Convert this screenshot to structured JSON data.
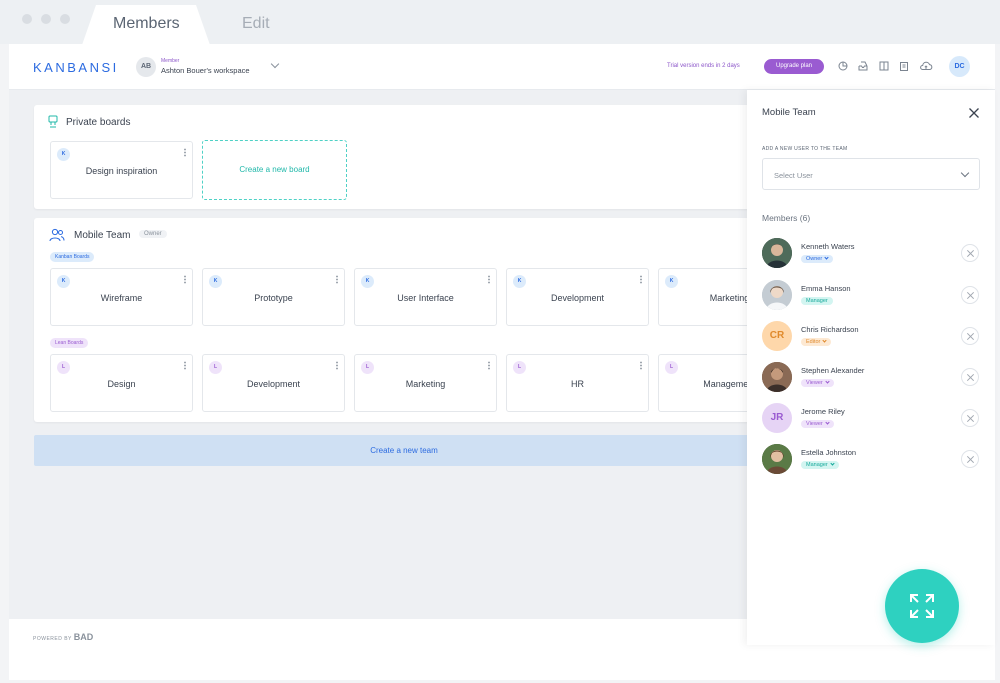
{
  "window": {
    "tabs": [
      {
        "label": "Members"
      },
      {
        "label": "Edit"
      }
    ]
  },
  "header": {
    "logo": "KANBANSI",
    "workspace": {
      "initials": "AB",
      "role": "Member",
      "name": "Ashton Bouer's workspace"
    },
    "trial_text": "Trial version ends in 2 days",
    "upgrade_label": "Upgrade plan",
    "icons": [
      "pie-chart-icon",
      "inbox-icon",
      "columns-icon",
      "clipboard-icon",
      "cloud-upload-icon"
    ],
    "user_initials": "DC"
  },
  "private_boards": {
    "title": "Private boards",
    "boards": [
      {
        "badge": "K",
        "name": "Design inspiration"
      }
    ],
    "create_label": "Create a new board"
  },
  "team": {
    "name": "Mobile Team",
    "role_badge": "Owner",
    "kanban_label": "Kanban Boards",
    "kanban_boards": [
      {
        "badge": "K",
        "name": "Wireframe"
      },
      {
        "badge": "K",
        "name": "Prototype"
      },
      {
        "badge": "K",
        "name": "User Interface"
      },
      {
        "badge": "K",
        "name": "Development"
      },
      {
        "badge": "K",
        "name": "Marketing"
      }
    ],
    "lean_label": "Lean Boards",
    "lean_boards": [
      {
        "badge": "L",
        "name": "Design"
      },
      {
        "badge": "L",
        "name": "Development"
      },
      {
        "badge": "L",
        "name": "Marketing"
      },
      {
        "badge": "L",
        "name": "HR"
      },
      {
        "badge": "L",
        "name": "Management"
      }
    ]
  },
  "create_team_label": "Create a new team",
  "footer": {
    "powered_prefix": "POWERED BY",
    "brand": "BAD"
  },
  "panel": {
    "title": "Mobile Team",
    "add_label": "ADD A NEW USER TO THE TEAM",
    "select_placeholder": "Select User",
    "members_label": "Members (6)",
    "members": [
      {
        "name": "Kenneth Waters",
        "role": "Owner",
        "avatar": "photo",
        "initials": "",
        "role_color": "#2c6be0",
        "role_bg": "#dcebfb"
      },
      {
        "name": "Emma Hanson",
        "role": "Manager",
        "avatar": "photo",
        "initials": "",
        "role_color": "#17a99b",
        "role_bg": "#d3f5f1"
      },
      {
        "name": "Chris Richardson",
        "role": "Editor",
        "avatar": "initials",
        "initials": "CR",
        "role_color": "#e08a2c",
        "role_bg": "#fde9d3"
      },
      {
        "name": "Stephen Alexander",
        "role": "Viewer",
        "avatar": "photo",
        "initials": "",
        "role_color": "#9a5bd1",
        "role_bg": "#efe3fa"
      },
      {
        "name": "Jerome Riley",
        "role": "Viewer",
        "avatar": "initials",
        "initials": "JR",
        "role_color": "#9a5bd1",
        "role_bg": "#efe3fa"
      },
      {
        "name": "Estella Johnston",
        "role": "Manager",
        "avatar": "photo",
        "initials": "",
        "role_color": "#17a99b",
        "role_bg": "#d3f5f1"
      }
    ]
  },
  "colors": {
    "brand_blue": "#2c6be0",
    "purple": "#9a5bd1",
    "teal": "#2ed1c0"
  }
}
